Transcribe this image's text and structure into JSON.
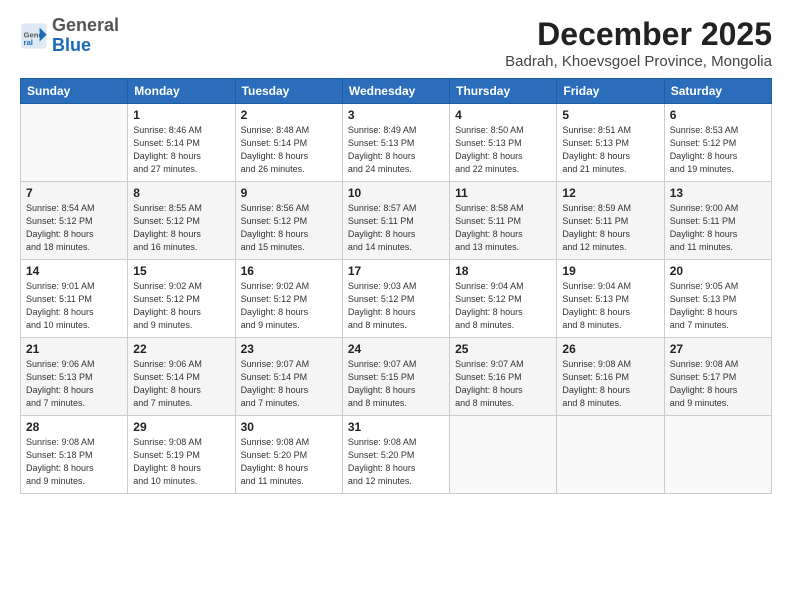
{
  "logo": {
    "general": "General",
    "blue": "Blue"
  },
  "title": {
    "month_year": "December 2025",
    "location": "Badrah, Khoevsgoel Province, Mongolia"
  },
  "header_days": [
    "Sunday",
    "Monday",
    "Tuesday",
    "Wednesday",
    "Thursday",
    "Friday",
    "Saturday"
  ],
  "weeks": [
    [
      {
        "day": "",
        "info": ""
      },
      {
        "day": "1",
        "info": "Sunrise: 8:46 AM\nSunset: 5:14 PM\nDaylight: 8 hours\nand 27 minutes."
      },
      {
        "day": "2",
        "info": "Sunrise: 8:48 AM\nSunset: 5:14 PM\nDaylight: 8 hours\nand 26 minutes."
      },
      {
        "day": "3",
        "info": "Sunrise: 8:49 AM\nSunset: 5:13 PM\nDaylight: 8 hours\nand 24 minutes."
      },
      {
        "day": "4",
        "info": "Sunrise: 8:50 AM\nSunset: 5:13 PM\nDaylight: 8 hours\nand 22 minutes."
      },
      {
        "day": "5",
        "info": "Sunrise: 8:51 AM\nSunset: 5:13 PM\nDaylight: 8 hours\nand 21 minutes."
      },
      {
        "day": "6",
        "info": "Sunrise: 8:53 AM\nSunset: 5:12 PM\nDaylight: 8 hours\nand 19 minutes."
      }
    ],
    [
      {
        "day": "7",
        "info": "Sunrise: 8:54 AM\nSunset: 5:12 PM\nDaylight: 8 hours\nand 18 minutes."
      },
      {
        "day": "8",
        "info": "Sunrise: 8:55 AM\nSunset: 5:12 PM\nDaylight: 8 hours\nand 16 minutes."
      },
      {
        "day": "9",
        "info": "Sunrise: 8:56 AM\nSunset: 5:12 PM\nDaylight: 8 hours\nand 15 minutes."
      },
      {
        "day": "10",
        "info": "Sunrise: 8:57 AM\nSunset: 5:11 PM\nDaylight: 8 hours\nand 14 minutes."
      },
      {
        "day": "11",
        "info": "Sunrise: 8:58 AM\nSunset: 5:11 PM\nDaylight: 8 hours\nand 13 minutes."
      },
      {
        "day": "12",
        "info": "Sunrise: 8:59 AM\nSunset: 5:11 PM\nDaylight: 8 hours\nand 12 minutes."
      },
      {
        "day": "13",
        "info": "Sunrise: 9:00 AM\nSunset: 5:11 PM\nDaylight: 8 hours\nand 11 minutes."
      }
    ],
    [
      {
        "day": "14",
        "info": "Sunrise: 9:01 AM\nSunset: 5:11 PM\nDaylight: 8 hours\nand 10 minutes."
      },
      {
        "day": "15",
        "info": "Sunrise: 9:02 AM\nSunset: 5:12 PM\nDaylight: 8 hours\nand 9 minutes."
      },
      {
        "day": "16",
        "info": "Sunrise: 9:02 AM\nSunset: 5:12 PM\nDaylight: 8 hours\nand 9 minutes."
      },
      {
        "day": "17",
        "info": "Sunrise: 9:03 AM\nSunset: 5:12 PM\nDaylight: 8 hours\nand 8 minutes."
      },
      {
        "day": "18",
        "info": "Sunrise: 9:04 AM\nSunset: 5:12 PM\nDaylight: 8 hours\nand 8 minutes."
      },
      {
        "day": "19",
        "info": "Sunrise: 9:04 AM\nSunset: 5:13 PM\nDaylight: 8 hours\nand 8 minutes."
      },
      {
        "day": "20",
        "info": "Sunrise: 9:05 AM\nSunset: 5:13 PM\nDaylight: 8 hours\nand 7 minutes."
      }
    ],
    [
      {
        "day": "21",
        "info": "Sunrise: 9:06 AM\nSunset: 5:13 PM\nDaylight: 8 hours\nand 7 minutes."
      },
      {
        "day": "22",
        "info": "Sunrise: 9:06 AM\nSunset: 5:14 PM\nDaylight: 8 hours\nand 7 minutes."
      },
      {
        "day": "23",
        "info": "Sunrise: 9:07 AM\nSunset: 5:14 PM\nDaylight: 8 hours\nand 7 minutes."
      },
      {
        "day": "24",
        "info": "Sunrise: 9:07 AM\nSunset: 5:15 PM\nDaylight: 8 hours\nand 8 minutes."
      },
      {
        "day": "25",
        "info": "Sunrise: 9:07 AM\nSunset: 5:16 PM\nDaylight: 8 hours\nand 8 minutes."
      },
      {
        "day": "26",
        "info": "Sunrise: 9:08 AM\nSunset: 5:16 PM\nDaylight: 8 hours\nand 8 minutes."
      },
      {
        "day": "27",
        "info": "Sunrise: 9:08 AM\nSunset: 5:17 PM\nDaylight: 8 hours\nand 9 minutes."
      }
    ],
    [
      {
        "day": "28",
        "info": "Sunrise: 9:08 AM\nSunset: 5:18 PM\nDaylight: 8 hours\nand 9 minutes."
      },
      {
        "day": "29",
        "info": "Sunrise: 9:08 AM\nSunset: 5:19 PM\nDaylight: 8 hours\nand 10 minutes."
      },
      {
        "day": "30",
        "info": "Sunrise: 9:08 AM\nSunset: 5:20 PM\nDaylight: 8 hours\nand 11 minutes."
      },
      {
        "day": "31",
        "info": "Sunrise: 9:08 AM\nSunset: 5:20 PM\nDaylight: 8 hours\nand 12 minutes."
      },
      {
        "day": "",
        "info": ""
      },
      {
        "day": "",
        "info": ""
      },
      {
        "day": "",
        "info": ""
      }
    ]
  ]
}
